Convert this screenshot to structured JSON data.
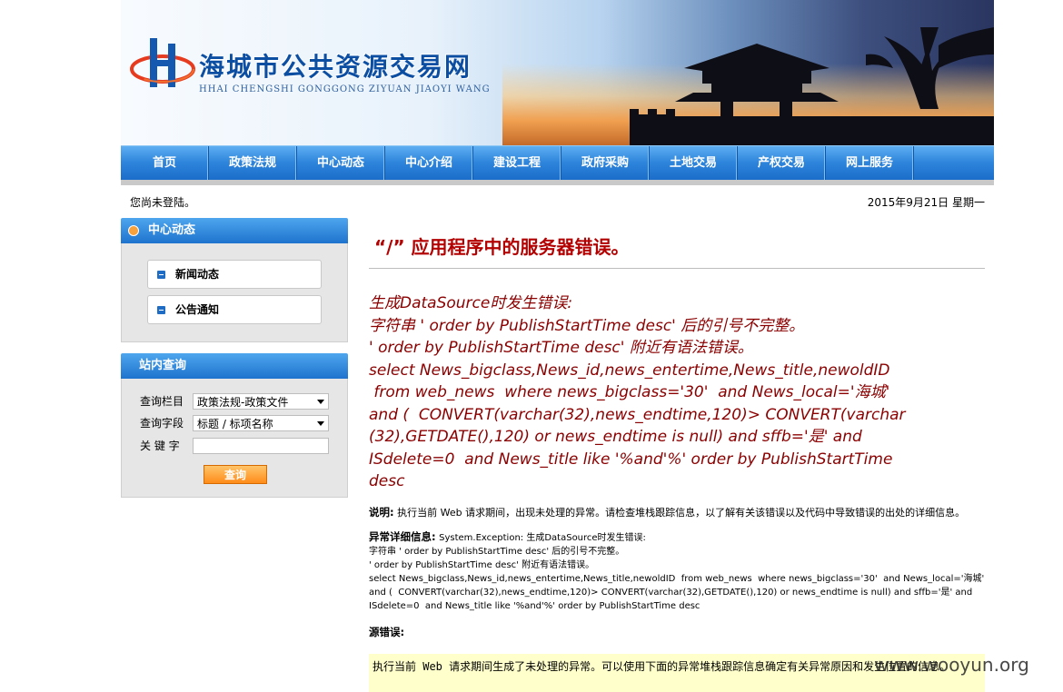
{
  "header": {
    "site_title": "海城市公共资源交易网",
    "site_subtitle": "HHAI CHENGSHI GONGGONG ZIYUAN JIAOYI WANG"
  },
  "nav": {
    "items": [
      "首页",
      "政策法规",
      "中心动态",
      "中心介绍",
      "建设工程",
      "政府采购",
      "土地交易",
      "产权交易",
      "网上服务"
    ]
  },
  "status": {
    "login": "您尚未登陆。",
    "date": "2015年9月21日 星期一"
  },
  "sidebar": {
    "news_title": "中心动态",
    "news_items": [
      "新闻动态",
      "公告通知"
    ],
    "search_title": "站内查询",
    "search": {
      "column_label": "查询栏目",
      "column_value": "政策法规-政策文件",
      "field_label": "查询字段",
      "field_value": "标题 / 标项名称",
      "keyword_label": "关 键 字",
      "keyword_value": "",
      "submit": "查询"
    }
  },
  "error": {
    "title": "“/” 应用程序中的服务器错误。",
    "message": "生成DataSource时发生错误:\n字符串 ' order by PublishStartTime desc' 后的引号不完整。\n' order by PublishStartTime desc' 附近有语法错误。\nselect News_bigclass,News_id,news_entertime,News_title,newoldID\n from web_news  where news_bigclass='30'  and News_local='海城'\nand (  CONVERT(varchar(32),news_endtime,120)> CONVERT(varchar\n(32),GETDATE(),120) or news_endtime is null) and sffb='是' and\nISdelete=0  and News_title like '%and'%' order by PublishStartTime\ndesc",
    "desc_label": "说明:",
    "desc_text": "执行当前 Web 请求期间，出现未处理的异常。请检查堆栈跟踪信息，以了解有关该错误以及代码中导致错误的出处的详细信息。",
    "exc_label": "异常详细信息:",
    "exc_head": "System.Exception: 生成DataSource时发生错误:",
    "exc_text": "字符串 ' order by PublishStartTime desc' 后的引号不完整。\n' order by PublishStartTime desc' 附近有语法错误。\nselect News_bigclass,News_id,news_entertime,News_title,newoldID  from web_news  where news_bigclass='30'  and News_local='海城'\nand (  CONVERT(varchar(32),news_endtime,120)> CONVERT(varchar(32),GETDATE(),120) or news_endtime is null) and sffb='是' and\nISdelete=0  and News_title like '%and'%' order by PublishStartTime desc",
    "src_label": "源错误:",
    "src_text": "执行当前 Web 请求期间生成了未处理的异常。可以使用下面的异常堆栈跟踪信息确定有关异常原因和发生位置的信息。"
  },
  "watermark": "www.wooyun.org"
}
